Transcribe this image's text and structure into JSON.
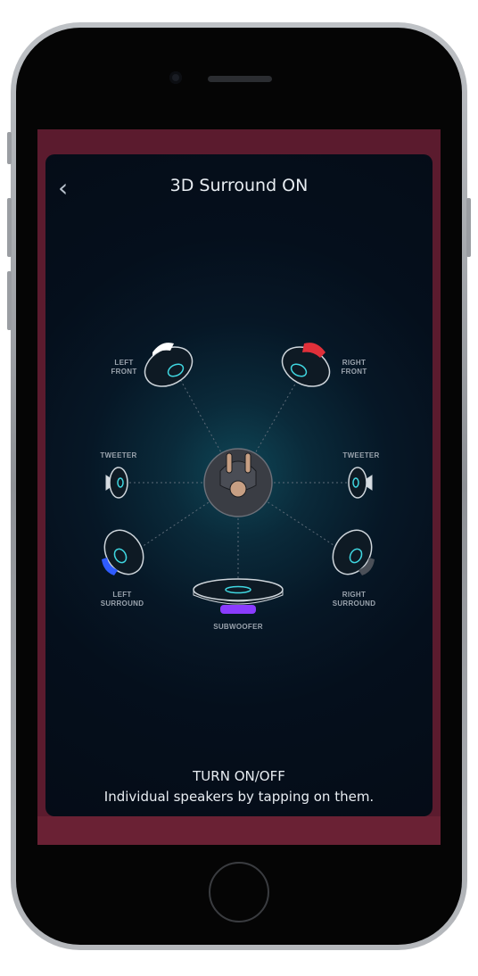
{
  "header": {
    "back_icon": "chevron-left-icon",
    "title": "3D Surround ON"
  },
  "speakers": {
    "left_front": [
      "LEFT",
      "FRONT"
    ],
    "right_front": [
      "RIGHT",
      "FRONT"
    ],
    "tweeter_left": "TWEETER",
    "tweeter_right": "TWEETER",
    "left_surround": [
      "LEFT",
      "SURROUND"
    ],
    "right_surround": [
      "RIGHT",
      "SURROUND"
    ],
    "subwoofer": "SUBWOOFER"
  },
  "footer": {
    "title": "TURN ON/OFF",
    "subtitle": "Individual speakers by tapping on them."
  },
  "colors": {
    "accent_cyan": "#3fd6e0",
    "left_front": "#ffffff",
    "right_front": "#e0303a",
    "left_surround": "#2f5cff",
    "subwoofer": "#8a3cff",
    "screen_bg": "#5b1b2e"
  }
}
